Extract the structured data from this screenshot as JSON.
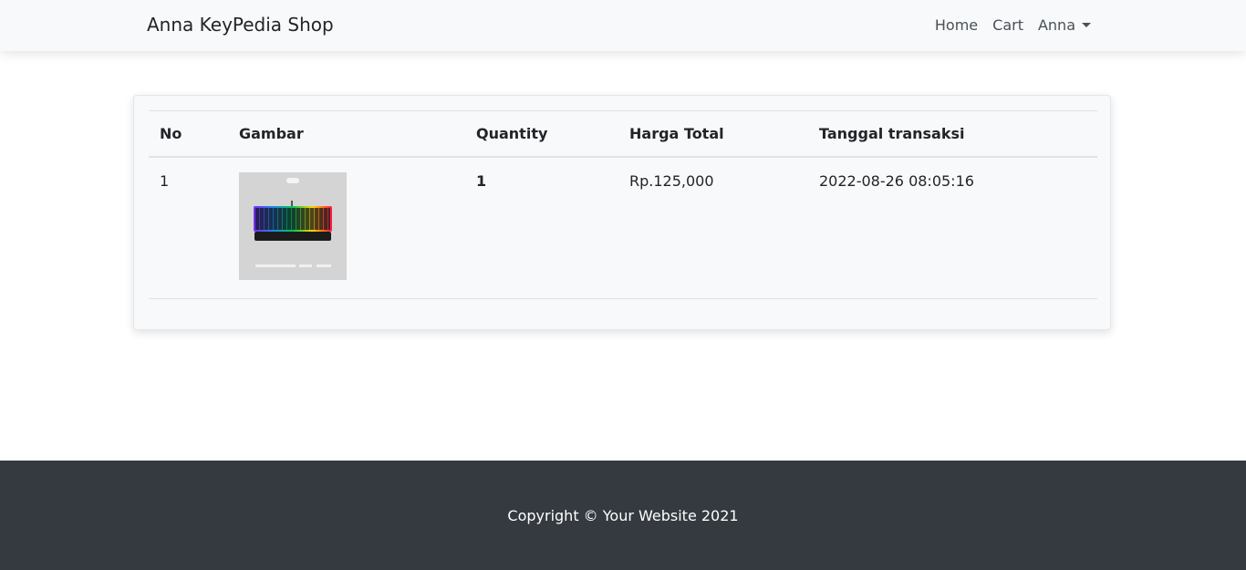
{
  "navbar": {
    "brand": "Anna KeyPedia Shop",
    "links": [
      "Home",
      "Cart"
    ],
    "user": "Anna"
  },
  "table": {
    "headers": [
      "No",
      "Gambar",
      "Quantity",
      "Harga Total",
      "Tanggal transaksi"
    ],
    "rows": [
      {
        "no": "1",
        "quantity": "1",
        "total": "Rp.125,000",
        "date": "2022-08-26 08:05:16"
      }
    ]
  },
  "footer": {
    "copyright": "Copyright © Your Website 2021"
  }
}
